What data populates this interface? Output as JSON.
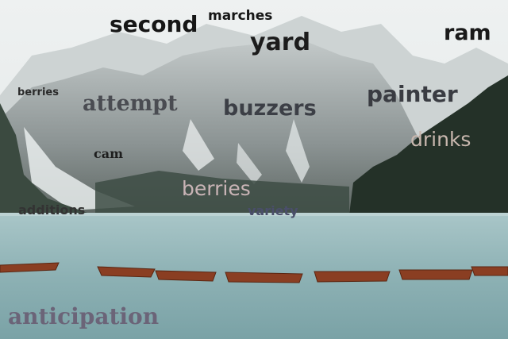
{
  "scene": {
    "description_colors": {
      "sky": "#e8ecec",
      "mountain": "#9aa1a1",
      "forest": "#2c3a2f",
      "lake": "#8fb5b8",
      "boat": "#8a3e22"
    }
  },
  "words": [
    {
      "id": "second",
      "text": "second",
      "color": "#161616"
    },
    {
      "id": "marches",
      "text": "marches",
      "color": "#161616"
    },
    {
      "id": "yard",
      "text": "yard",
      "color": "#1c1c1c"
    },
    {
      "id": "ram",
      "text": "ram",
      "color": "#1a1a1a"
    },
    {
      "id": "berries-top",
      "text": "berries",
      "color": "#2a2a2a"
    },
    {
      "id": "attempt",
      "text": "attempt",
      "color": "#4a4c52"
    },
    {
      "id": "buzzers",
      "text": "buzzers",
      "color": "#3c3f46"
    },
    {
      "id": "painter",
      "text": "painter",
      "color": "#3a3c42"
    },
    {
      "id": "drinks",
      "text": "drinks",
      "color": "#c8b7ae"
    },
    {
      "id": "cam",
      "text": "cam",
      "color": "#1e1e1e"
    },
    {
      "id": "berries-mid",
      "text": "berries",
      "color": "#c9b4b6"
    },
    {
      "id": "additions",
      "text": "additions",
      "color": "#333333"
    },
    {
      "id": "variety",
      "text": "variety",
      "color": "#4a4e6a"
    },
    {
      "id": "anticipation",
      "text": "anticipation",
      "color": "#6b6478"
    }
  ]
}
